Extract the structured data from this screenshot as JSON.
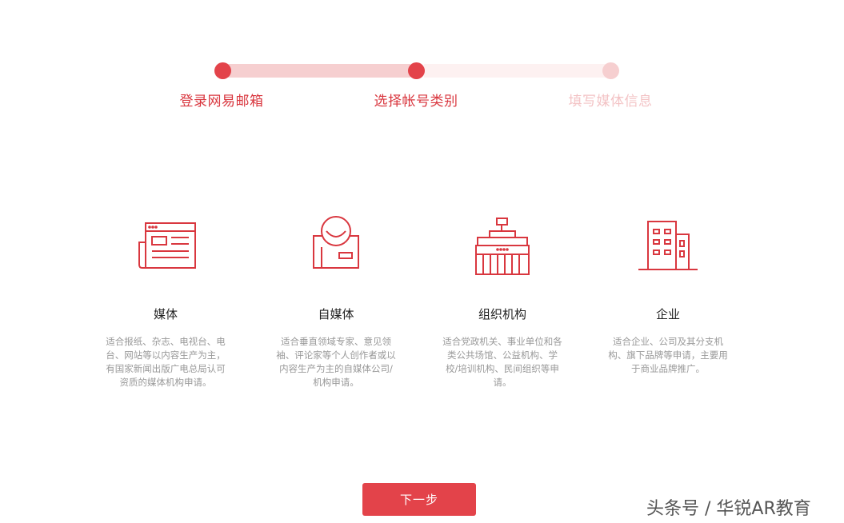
{
  "stepper": {
    "steps": [
      {
        "label": "登录网易邮箱",
        "state": "done"
      },
      {
        "label": "选择帐号类别",
        "state": "current"
      },
      {
        "label": "填写媒体信息",
        "state": "pending"
      }
    ]
  },
  "account_types": [
    {
      "icon": "newspaper-icon",
      "title": "媒体",
      "description": "适合报纸、杂志、电视台、电台、网站等以内容生产为主，有国家新闻出版广电总局认可资质的媒体机构申请。"
    },
    {
      "icon": "person-badge-icon",
      "title": "自媒体",
      "description": "适合垂直领域专家、意见领袖、评论家等个人创作者或以内容生产为主的自媒体公司/机构申请。"
    },
    {
      "icon": "government-building-icon",
      "title": "组织机构",
      "description": "适合党政机关、事业单位和各类公共场馆、公益机构、学校/培训机构、民间组织等申请。"
    },
    {
      "icon": "office-building-icon",
      "title": "企业",
      "description": "适合企业、公司及其分支机构、旗下品牌等申请，主要用于商业品牌推广。"
    }
  ],
  "next_button": {
    "label": "下一步"
  },
  "watermark": {
    "text": "头条号 / 华锐AR教育"
  },
  "colors": {
    "accent": "#e3434a",
    "track_done": "#f6cfd0",
    "track_todo": "#fdf1f1",
    "pending_text": "#f3c3c5"
  }
}
